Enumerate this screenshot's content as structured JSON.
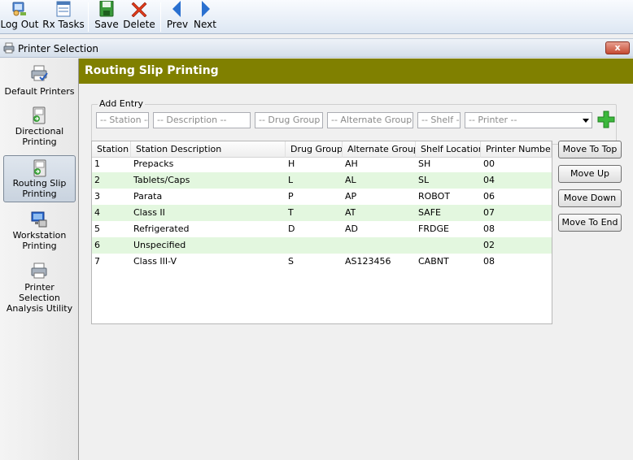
{
  "toolbar": {
    "logout_label": "Log Out",
    "rxtasks_label": "Rx Tasks",
    "save_label": "Save",
    "delete_label": "Delete",
    "prev_label": "Prev",
    "next_label": "Next"
  },
  "window": {
    "title": "Printer Selection",
    "close_label": "x"
  },
  "sidebar": {
    "items": [
      {
        "label": "Default Printers",
        "selected": false
      },
      {
        "label": "Directional Printing",
        "selected": false
      },
      {
        "label": "Routing Slip Printing",
        "selected": true
      },
      {
        "label": "Workstation Printing",
        "selected": false
      },
      {
        "label": "Printer Selection Analysis Utility",
        "selected": false
      }
    ]
  },
  "header": {
    "title": "Routing Slip Printing",
    "color": "#808000"
  },
  "add_entry": {
    "label": "Add Entry",
    "station_placeholder": "-- Station --",
    "description_placeholder": "-- Description --",
    "drug_group_placeholder": "-- Drug Group --",
    "alternate_group_placeholder": "-- Alternate Group --",
    "shelf_placeholder": "-- Shelf --",
    "printer_placeholder": "-- Printer --"
  },
  "table": {
    "columns": [
      "Station",
      "Station Description",
      "Drug Group",
      "Alternate Group",
      "Shelf Location",
      "Printer Number"
    ],
    "rows": [
      [
        "1",
        "Prepacks",
        "H",
        "AH",
        "SH",
        "00"
      ],
      [
        "2",
        "Tablets/Caps",
        "L",
        "AL",
        "SL",
        "04"
      ],
      [
        "3",
        "Parata",
        "P",
        "AP",
        "ROBOT",
        "06"
      ],
      [
        "4",
        "Class II",
        "T",
        "AT",
        "SAFE",
        "07"
      ],
      [
        "5",
        "Refrigerated",
        "D",
        "AD",
        "FRDGE",
        "08"
      ],
      [
        "6",
        "Unspecified",
        "",
        "",
        "",
        "02"
      ],
      [
        "7",
        "Class III-V",
        "S",
        "AS123456",
        "CABNT",
        "08"
      ]
    ],
    "row_alt_color": "#e3f7df"
  },
  "side_buttons": {
    "move_top": "Move To Top",
    "move_up": "Move Up",
    "move_down": "Move Down",
    "move_end": "Move To End"
  }
}
